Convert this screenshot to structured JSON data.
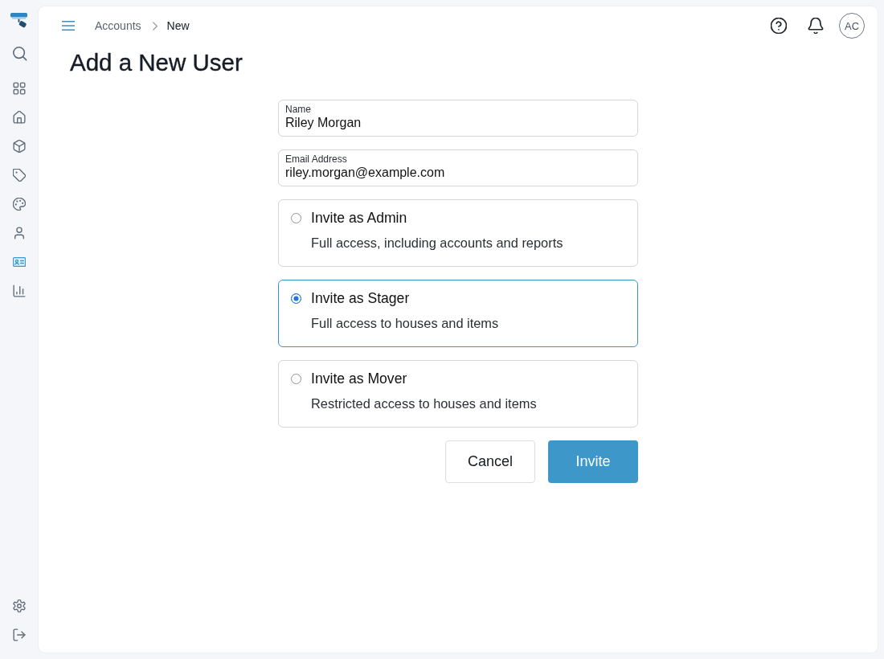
{
  "sidebar": {
    "nav_items": [
      {
        "selected": false
      },
      {
        "selected": false
      },
      {
        "selected": false
      },
      {
        "selected": false
      },
      {
        "selected": false
      },
      {
        "selected": false
      },
      {
        "selected": true
      },
      {
        "selected": false
      }
    ]
  },
  "header": {
    "breadcrumb": [
      "Accounts",
      "New"
    ],
    "avatar_initials": "AC"
  },
  "page_title": "Add a New User",
  "form": {
    "fields": [
      {
        "label": "Name",
        "value": "Riley Morgan"
      },
      {
        "label": "Email Address",
        "value": "riley.morgan@example.com"
      }
    ],
    "roles": [
      {
        "title": "Invite as Admin",
        "description": "Full access, including accounts and reports",
        "selected": false
      },
      {
        "title": "Invite as Stager",
        "description": "Full access to houses and items",
        "selected": true
      },
      {
        "title": "Invite as Mover",
        "description": "Restricted access to houses and items",
        "selected": false
      }
    ],
    "buttons": [
      {
        "label": "Cancel",
        "kind": "secondary"
      },
      {
        "label": "Invite",
        "kind": "primary"
      }
    ]
  }
}
